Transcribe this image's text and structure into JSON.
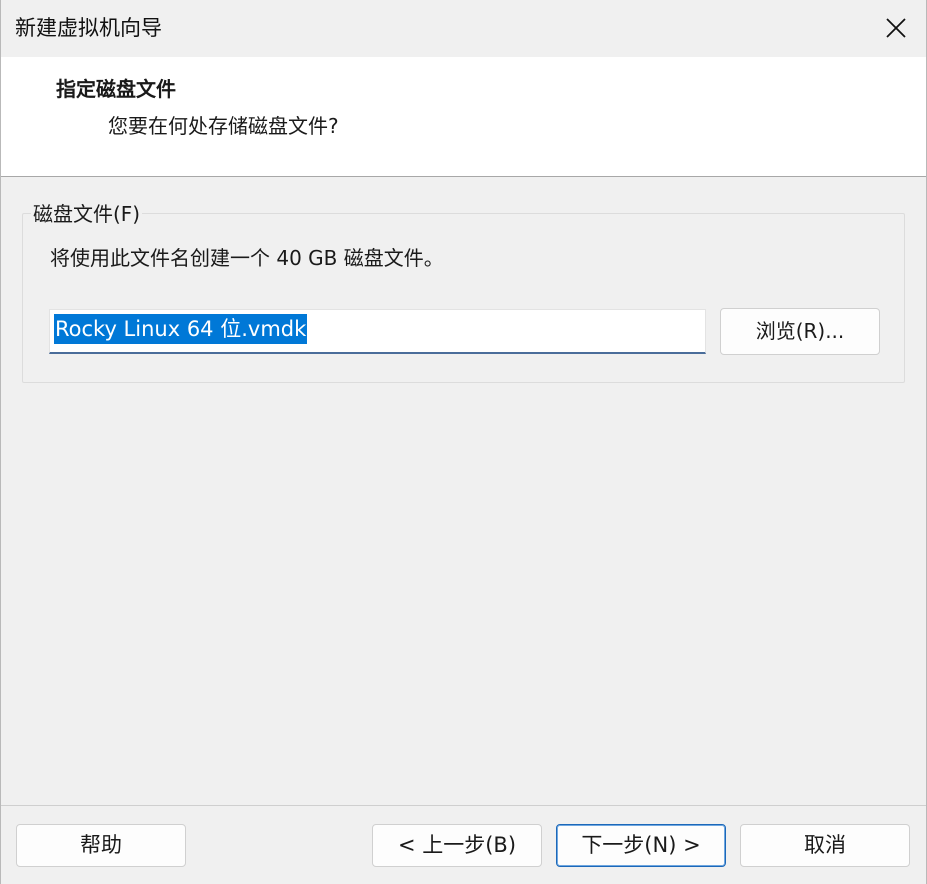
{
  "window": {
    "title": "新建虚拟机向导"
  },
  "header": {
    "title": "指定磁盘文件",
    "subtitle": "您要在何处存储磁盘文件?"
  },
  "disk_file_group": {
    "legend": "磁盘文件(F)",
    "description": "将使用此文件名创建一个 40 GB 磁盘文件。",
    "file_name_value": "Rocky Linux 64 位.vmdk",
    "browse_label": "浏览(R)..."
  },
  "footer": {
    "help_label": "帮助",
    "back_label": "< 上一步(B)",
    "next_label": "下一步(N) >",
    "cancel_label": "取消"
  },
  "colors": {
    "selection": "#0078d7",
    "default_button_border": "#1c68b9"
  }
}
